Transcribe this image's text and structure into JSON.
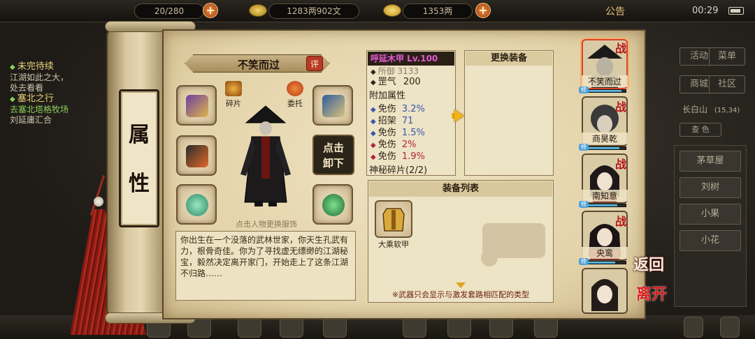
{
  "topbar": {
    "stamina": "20/280",
    "coins": "1283两902文",
    "gold": "1353两",
    "notice": "公告",
    "time": "00:29"
  },
  "quests": {
    "q1_title": "未完待续",
    "q1_line1": "江湖如此之大，",
    "q1_line2": "处去看看",
    "q2_title": "塞北之行",
    "q2_line1": "去塞北塔格牧场",
    "q2_line2": "刘延庸汇合"
  },
  "side_menu": {
    "activity": "活动",
    "menu": "菜单",
    "shop": "商城",
    "community": "社区",
    "location": "长白山",
    "coords": "(15,34)",
    "small_btn": "查 色"
  },
  "location_list": [
    "茅草屋",
    "刘树",
    "小果",
    "小花"
  ],
  "scroll": {
    "char1": "属",
    "char2": "性"
  },
  "character": {
    "name": "不笑而过",
    "rate_label": "评",
    "shard_label": "碎片",
    "delegate_label": "委托",
    "unequip_line1": "点击",
    "unequip_line2": "卸下",
    "outfit_tip": "点击人物更换服饰",
    "bio": "你出生在一个没落的武林世家，你天生孔武有力，根骨奇佳。你为了寻找虚无缥缈的江湖秘宝，毅然决定离开家门，开始走上了这条江湖不归路……"
  },
  "equipment": {
    "title": "呼延木甲 Lv.100",
    "clipped_row": "所御 3133",
    "qi_label": "罡气",
    "qi_value": "200",
    "extra_title": "附加属性",
    "extras": [
      {
        "label": "免伤",
        "value": "3.2%",
        "color": "blue"
      },
      {
        "label": "招架",
        "value": "71",
        "color": "blue"
      },
      {
        "label": "免伤",
        "value": "1.5%",
        "color": "blue"
      },
      {
        "label": "免伤",
        "value": "2%",
        "color": "red"
      },
      {
        "label": "免伤",
        "value": "1.9%",
        "color": "red"
      }
    ],
    "shards": "神秘碎片(2/2)",
    "swap_title": "更换装备",
    "list_title": "装备列表",
    "list_item": "大乘软甲",
    "list_tip": "※武器只会显示与激发套路相匹配的类型"
  },
  "party": [
    {
      "name": "不笑而过",
      "tag": "战",
      "hp": 0.9
    },
    {
      "name": "商昊乾",
      "tag": "战",
      "hp": 0.85
    },
    {
      "name": "南知意",
      "tag": "战",
      "hp": 0.8
    },
    {
      "name": "央鸾",
      "tag": "战",
      "hp": 0.75
    }
  ],
  "exit_buttons": {
    "back": "返回",
    "leave": "离开"
  },
  "colors": {
    "accent_red": "#b8161a",
    "gold": "#f3b21a",
    "item_title": "#e35ad7"
  }
}
